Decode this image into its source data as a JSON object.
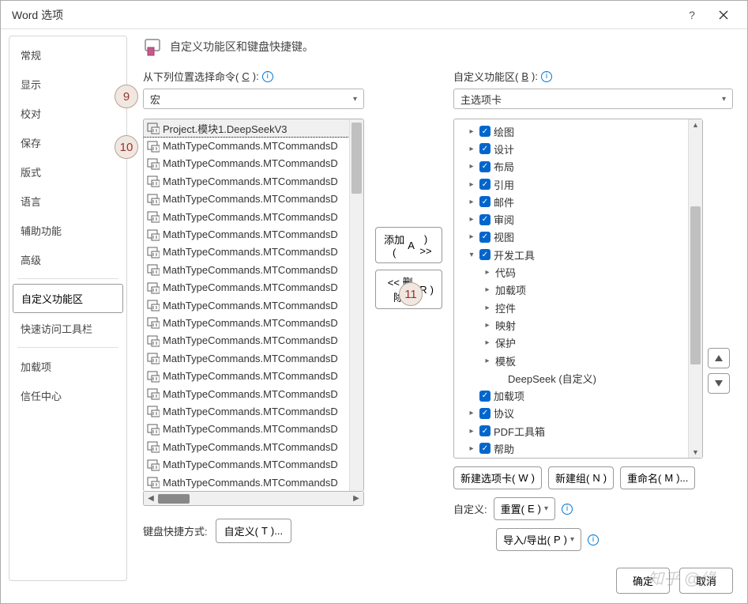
{
  "title": "Word 选项",
  "sidebar": [
    "常规",
    "显示",
    "校对",
    "保存",
    "版式",
    "语言",
    "辅助功能",
    "高级",
    "自定义功能区",
    "快速访问工具栏",
    "加载项",
    "信任中心"
  ],
  "sidebar_active": 8,
  "sidebar_separators_after": [
    7,
    9
  ],
  "header_text": "自定义功能区和键盘快捷键。",
  "left": {
    "label_pre": "从下列位置选择命令(",
    "label_ul": "C",
    "label_post": "):",
    "combo": "宏",
    "items": [
      "Project.模块1.DeepSeekV3",
      "MathTypeCommands.MTCommandsD",
      "MathTypeCommands.MTCommandsD",
      "MathTypeCommands.MTCommandsD",
      "MathTypeCommands.MTCommandsD",
      "MathTypeCommands.MTCommandsD",
      "MathTypeCommands.MTCommandsD",
      "MathTypeCommands.MTCommandsD",
      "MathTypeCommands.MTCommandsD",
      "MathTypeCommands.MTCommandsD",
      "MathTypeCommands.MTCommandsD",
      "MathTypeCommands.MTCommandsD",
      "MathTypeCommands.MTCommandsD",
      "MathTypeCommands.MTCommandsD",
      "MathTypeCommands.MTCommandsD",
      "MathTypeCommands.MTCommandsD",
      "MathTypeCommands.MTCommandsD",
      "MathTypeCommands.MTCommandsD",
      "MathTypeCommands.MTCommandsD",
      "MathTypeCommands.MTCommandsD",
      "MathTypeCommands.MTCommandsD"
    ],
    "selected": 0
  },
  "mid": {
    "add_pre": "添加(",
    "add_ul": "A",
    "add_post": ") >>",
    "remove_pre": "<< 删除(",
    "remove_ul": "R",
    "remove_post": ")"
  },
  "right": {
    "label_pre": "自定义功能区(",
    "label_ul": "B",
    "label_post": "):",
    "combo": "主选项卡",
    "tree": [
      {
        "indent": 1,
        "exp": ">",
        "cb": true,
        "label": "绘图"
      },
      {
        "indent": 1,
        "exp": ">",
        "cb": true,
        "label": "设计"
      },
      {
        "indent": 1,
        "exp": ">",
        "cb": true,
        "label": "布局"
      },
      {
        "indent": 1,
        "exp": ">",
        "cb": true,
        "label": "引用"
      },
      {
        "indent": 1,
        "exp": ">",
        "cb": true,
        "label": "邮件"
      },
      {
        "indent": 1,
        "exp": ">",
        "cb": true,
        "label": "审阅"
      },
      {
        "indent": 1,
        "exp": ">",
        "cb": true,
        "label": "视图"
      },
      {
        "indent": 1,
        "exp": "v",
        "cb": true,
        "label": "开发工具"
      },
      {
        "indent": 2,
        "exp": ">",
        "cb": false,
        "label": "代码"
      },
      {
        "indent": 2,
        "exp": ">",
        "cb": false,
        "label": "加载项"
      },
      {
        "indent": 2,
        "exp": ">",
        "cb": false,
        "label": "控件"
      },
      {
        "indent": 2,
        "exp": ">",
        "cb": false,
        "label": "映射"
      },
      {
        "indent": 2,
        "exp": ">",
        "cb": false,
        "label": "保护"
      },
      {
        "indent": 2,
        "exp": ">",
        "cb": false,
        "label": "模板"
      },
      {
        "indent": 3,
        "exp": "",
        "cb": false,
        "label": "DeepSeek (自定义)"
      },
      {
        "indent": 1,
        "exp": "",
        "cb": true,
        "label": "加载项"
      },
      {
        "indent": 1,
        "exp": ">",
        "cb": true,
        "label": "协议"
      },
      {
        "indent": 1,
        "exp": ">",
        "cb": true,
        "label": "PDF工具箱"
      },
      {
        "indent": 1,
        "exp": ">",
        "cb": true,
        "label": "帮助"
      }
    ],
    "new_tab_pre": "新建选项卡(",
    "new_tab_ul": "W",
    "new_tab_post": ")",
    "new_group_pre": "新建组(",
    "new_group_ul": "N",
    "new_group_post": ")",
    "rename_pre": "重命名(",
    "rename_ul": "M",
    "rename_post": ")...",
    "custom_label": "自定义:",
    "reset_pre": "重置(",
    "reset_ul": "E",
    "reset_post": ")",
    "import_pre": "导入/导出(",
    "import_ul": "P",
    "import_post": ")"
  },
  "kbd": {
    "label": "键盘快捷方式:",
    "btn_pre": "自定义(",
    "btn_ul": "T",
    "btn_post": ")..."
  },
  "footer": {
    "ok": "确定",
    "cancel": "取消"
  },
  "bubbles": {
    "b9": "9",
    "b10": "10",
    "b11": "11"
  },
  "watermark": "知乎 @缘"
}
